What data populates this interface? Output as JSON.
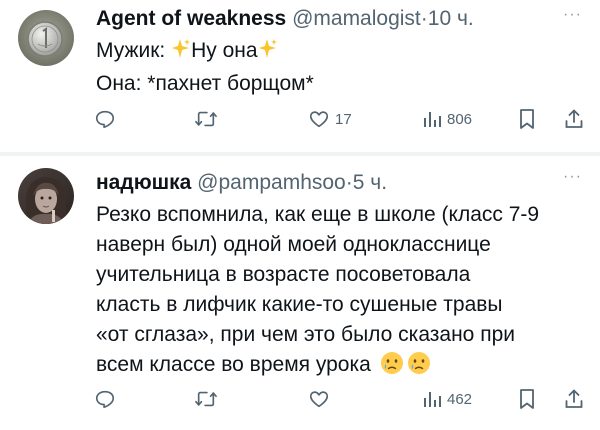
{
  "tweets": [
    {
      "name": "Agent of weakness",
      "handle": "@mamalogist",
      "separator": "·",
      "time": "10 ч.",
      "more": "···",
      "line1_prefix": "Мужик: ",
      "line1_word": "Ну она",
      "line2": "Она: *пахнет борщом*",
      "replies": "",
      "retweets": "",
      "likes": "17",
      "views": "806",
      "avatar_icon": "coin-avatar"
    },
    {
      "name": "надюшка",
      "handle": "@pampamhsoo",
      "separator": "·",
      "time": "5 ч.",
      "more": "···",
      "lines": [
        "Резко вспомнила, как еще в школе (класс 7-9",
        "наверн был) одной моей однокласснице",
        "учительница в возрасте посоветовала",
        "класть в лифчик какие-то сушеные травы",
        "«от сглаза», при чем это было сказано при",
        "всем классе во время урока"
      ],
      "emojis": [
        "crying-face-emoji",
        "crying-face-emoji"
      ],
      "replies": "",
      "retweets": "",
      "likes": "",
      "views": "462",
      "avatar_icon": "portrait-avatar"
    }
  ],
  "colors": {
    "text": "#0f1419",
    "secondary": "#536471",
    "divider": "#eff3f4",
    "sparkle": "#f7c52c",
    "emoji": "#ffcc4d"
  }
}
